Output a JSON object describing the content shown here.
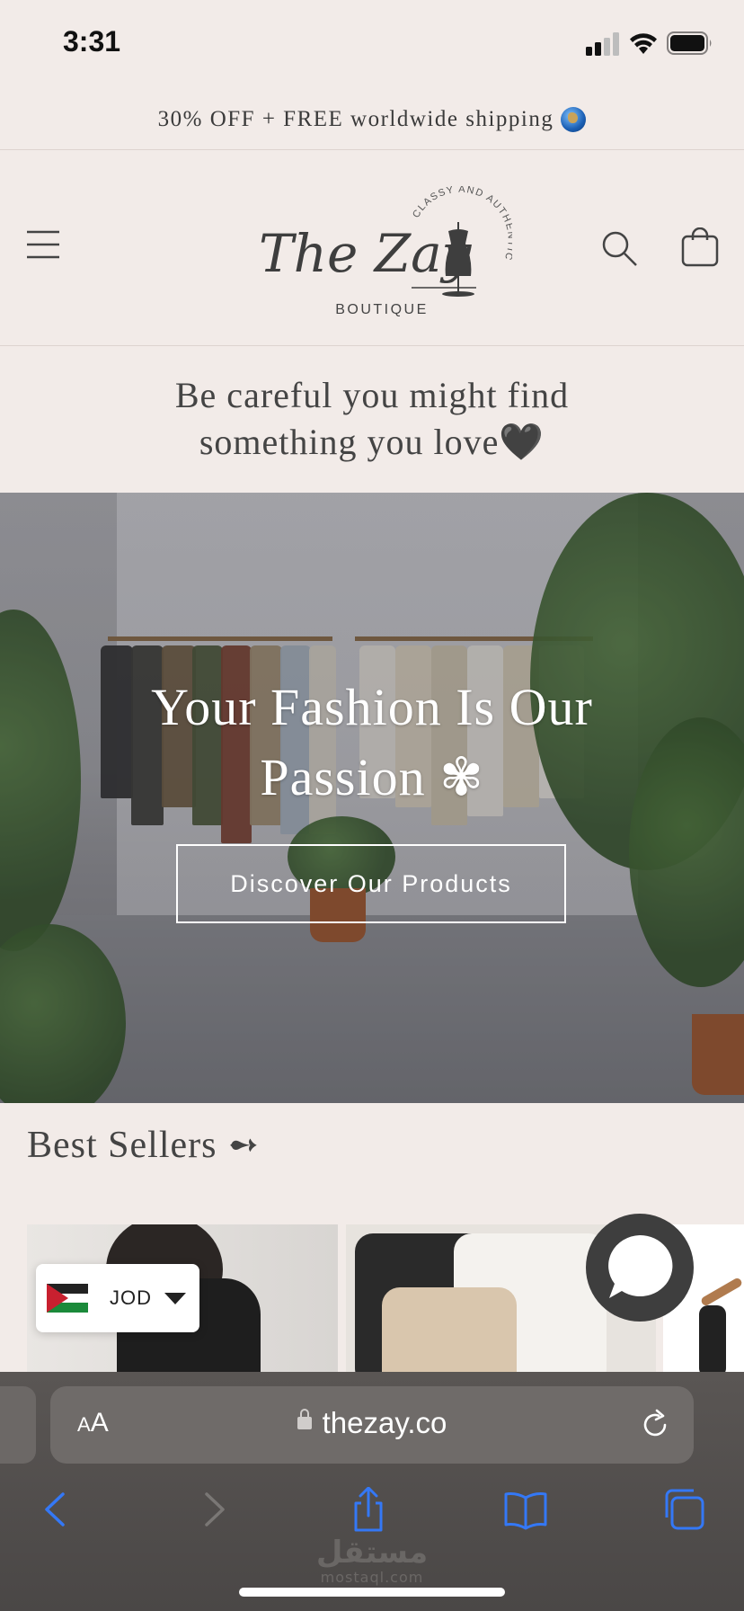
{
  "status_bar": {
    "time": "3:31"
  },
  "announcement": {
    "text": "30% OFF + FREE worldwide shipping",
    "icon": "globe-emoji"
  },
  "header": {
    "logo": {
      "script": "The Zay",
      "sub": "BOUTIQUE",
      "arc": "CLASSY AND AUTHENTIC"
    },
    "icons": [
      "menu-icon",
      "search-icon",
      "cart-icon"
    ]
  },
  "tagline": {
    "text": "Be careful you might find something you love🖤"
  },
  "hero": {
    "title": "Your Fashion Is Our Passion ✾",
    "button_label": "Discover Our Products"
  },
  "best_sellers": {
    "title": "Best Sellers ➻"
  },
  "currency": {
    "code": "JOD",
    "flag": "jordan-flag"
  },
  "browser": {
    "aa_label": "AA",
    "url": "thezay.co",
    "toolbar": [
      "back-icon",
      "forward-icon",
      "share-icon",
      "bookmarks-icon",
      "tabs-icon"
    ]
  },
  "watermark": {
    "arabic": "مستقل",
    "latin": "mostaql.com"
  },
  "colors": {
    "background": "#f2ebe8",
    "text": "#3b3b3b",
    "safari_accent": "#3478f6"
  }
}
